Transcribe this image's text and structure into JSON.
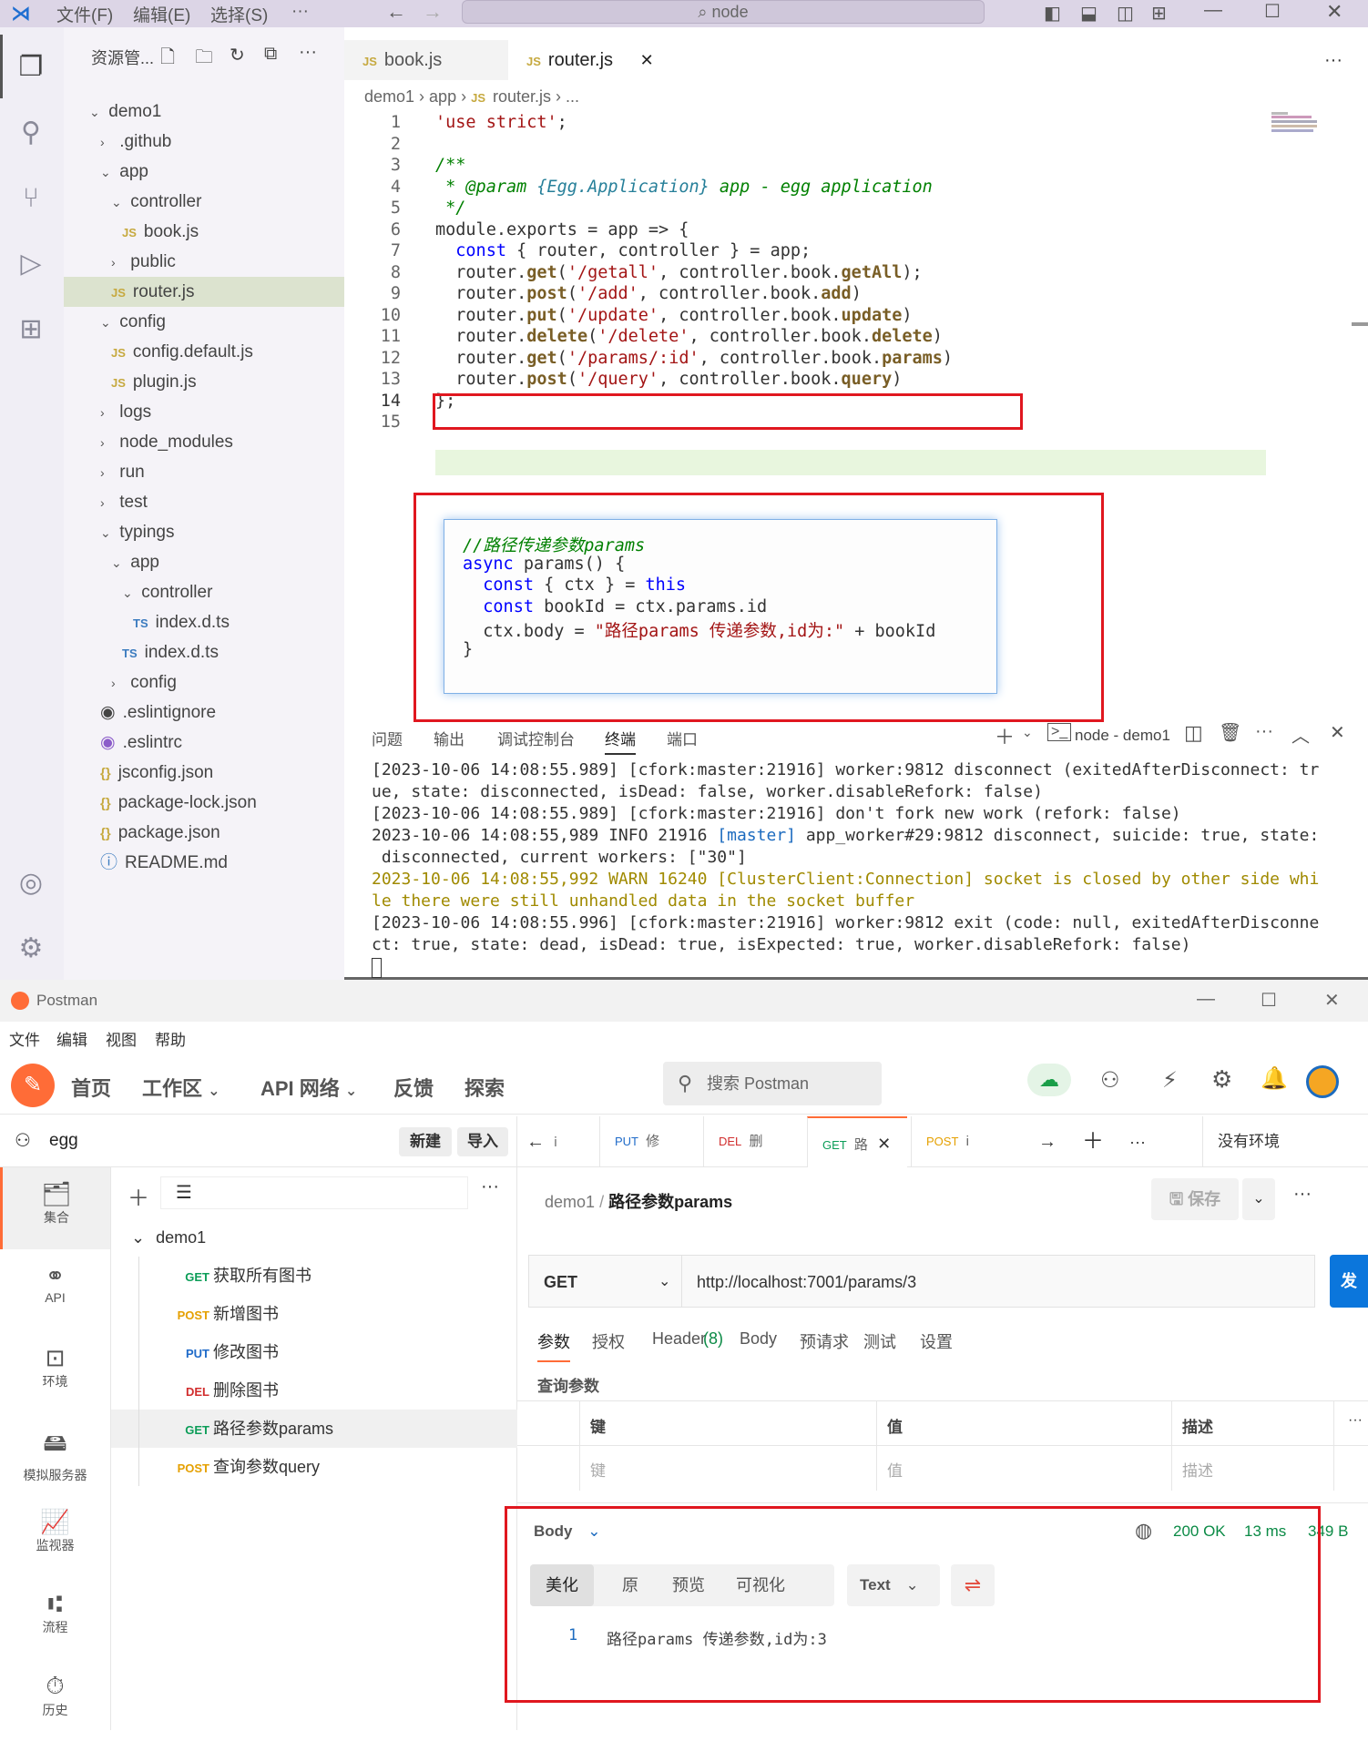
{
  "vscode": {
    "menus": [
      "文件(F)",
      "编辑(E)",
      "选择(S)",
      "···"
    ],
    "search": "node",
    "explorer_title": "资源管...",
    "tree": [
      {
        "label": "demo1",
        "type": "folder-open",
        "indent": 0
      },
      {
        "label": ".github",
        "type": "folder",
        "indent": 1
      },
      {
        "label": "app",
        "type": "folder-open",
        "indent": 1
      },
      {
        "label": "controller",
        "type": "folder-open",
        "indent": 2
      },
      {
        "label": "book.js",
        "type": "js",
        "indent": 3
      },
      {
        "label": "public",
        "type": "folder",
        "indent": 2
      },
      {
        "label": "router.js",
        "type": "js",
        "indent": 2,
        "selected": true
      },
      {
        "label": "config",
        "type": "folder-open",
        "indent": 1
      },
      {
        "label": "config.default.js",
        "type": "js",
        "indent": 2
      },
      {
        "label": "plugin.js",
        "type": "js",
        "indent": 2
      },
      {
        "label": "logs",
        "type": "folder",
        "indent": 1
      },
      {
        "label": "node_modules",
        "type": "folder",
        "indent": 1
      },
      {
        "label": "run",
        "type": "folder",
        "indent": 1
      },
      {
        "label": "test",
        "type": "folder",
        "indent": 1
      },
      {
        "label": "typings",
        "type": "folder-open",
        "indent": 1
      },
      {
        "label": "app",
        "type": "folder-open",
        "indent": 2
      },
      {
        "label": "controller",
        "type": "folder-open",
        "indent": 3
      },
      {
        "label": "index.d.ts",
        "type": "ts",
        "indent": 4
      },
      {
        "label": "index.d.ts",
        "type": "ts",
        "indent": 3
      },
      {
        "label": "config",
        "type": "folder",
        "indent": 2
      },
      {
        "label": ".eslintignore",
        "type": "gear",
        "indent": 1
      },
      {
        "label": ".eslintrc",
        "type": "eslint",
        "indent": 1
      },
      {
        "label": "jsconfig.json",
        "type": "json",
        "indent": 1
      },
      {
        "label": "package-lock.json",
        "type": "json",
        "indent": 1
      },
      {
        "label": "package.json",
        "type": "json",
        "indent": 1
      },
      {
        "label": "README.md",
        "type": "info",
        "indent": 1
      }
    ],
    "tabs": [
      {
        "label": "book.js",
        "badge": "JS"
      },
      {
        "label": "router.js",
        "badge": "JS"
      }
    ],
    "breadcrumb": [
      "demo1",
      "app",
      "JS",
      "router.js",
      "..."
    ],
    "code_lines": [
      "'use strict';",
      "",
      "/**",
      " * @param {Egg.Application} app - egg application",
      " */",
      "module.exports = app => {",
      "  const { router, controller } = app;",
      "  router.get('/getall', controller.book.getAll);",
      "  router.post('/add', controller.book.add)",
      "  router.put('/update', controller.book.update)",
      "  router.delete('/delete', controller.book.delete)",
      "  router.get('/params/:id', controller.book.params)",
      "  router.post('/query', controller.book.query)",
      "};",
      ""
    ],
    "popup_lines": [
      "//路径传递参数params",
      "async params() {",
      "  const { ctx } = this",
      "  const bookId = ctx.params.id",
      "  ctx.body = \"路径params 传递参数,id为:\" + bookId",
      "}"
    ],
    "panel_tabs": [
      "问题",
      "输出",
      "调试控制台",
      "终端",
      "端口"
    ],
    "terminal_name": "node - demo1",
    "terminal_lines": [
      "[2023-10-06 14:08:55.989] [cfork:master:21916] worker:9812 disconnect (exitedAfterDisconnect: tr",
      "ue, state: disconnected, isDead: false, worker.disableRefork: false)",
      "[2023-10-06 14:08:55.989] [cfork:master:21916] don't fork new work (refork: false)",
      "2023-10-06 14:08:55,989 INFO 21916 [master] app_worker#29:9812 disconnect, suicide: true, state:",
      " disconnected, current workers: [\"30\"]",
      "2023-10-06 14:08:55,992 WARN 16240 [ClusterClient:Connection] socket is closed by other side whi",
      "le there were still unhandled data in the socket buffer",
      "[2023-10-06 14:08:55.996] [cfork:master:21916] worker:9812 exit (code: null, exitedAfterDisconne",
      "ct: true, state: dead, isDead: true, isExpected: true, worker.disableRefork: false)"
    ]
  },
  "postman": {
    "title": "Postman",
    "menus": [
      "文件",
      "编辑",
      "视图",
      "帮助"
    ],
    "nav": [
      "首页",
      "工作区",
      "API 网络",
      "反馈",
      "探索"
    ],
    "search": "搜索 Postman",
    "workspace": "egg",
    "new_btn": "新建",
    "import_btn": "导入",
    "leftbar": [
      "集合",
      "API",
      "环境",
      "模拟服务器",
      "监视器",
      "流程",
      "历史"
    ],
    "collection": "demo1",
    "requests": [
      {
        "method": "GET",
        "name": "获取所有图书"
      },
      {
        "method": "POST",
        "name": "新增图书"
      },
      {
        "method": "PUT",
        "name": "修改图书"
      },
      {
        "method": "DEL",
        "name": "删除图书"
      },
      {
        "method": "GET",
        "name": "路径参数params"
      },
      {
        "method": "POST",
        "name": "查询参数query"
      }
    ],
    "req_tabs": [
      {
        "method": "PUT",
        "name": "修"
      },
      {
        "method": "DEL",
        "name": "删"
      },
      {
        "method": "GET",
        "name": "路"
      },
      {
        "method": "POST",
        "name": "i"
      }
    ],
    "env": "没有环境",
    "crumb_parent": "demo1",
    "crumb_current": "路径参数params",
    "save": "保存",
    "method": "GET",
    "url": "http://localhost:7001/params/3",
    "opt_tabs": [
      "参数",
      "授权",
      "Header",
      "(8)",
      "Body",
      "预请求",
      "测试",
      "设置"
    ],
    "query_title": "查询参数",
    "cols": [
      "键",
      "值",
      "描述"
    ],
    "placeholders": [
      "键",
      "值",
      "描述"
    ],
    "resp_label": "Body",
    "status": "200 OK",
    "time": "13 ms",
    "size": "349 B",
    "view_tabs": [
      "美化",
      "原",
      "预览",
      "可视化"
    ],
    "format": "Text",
    "resp_line_no": "1",
    "resp_body": "路径params 传递参数,id为:3"
  }
}
